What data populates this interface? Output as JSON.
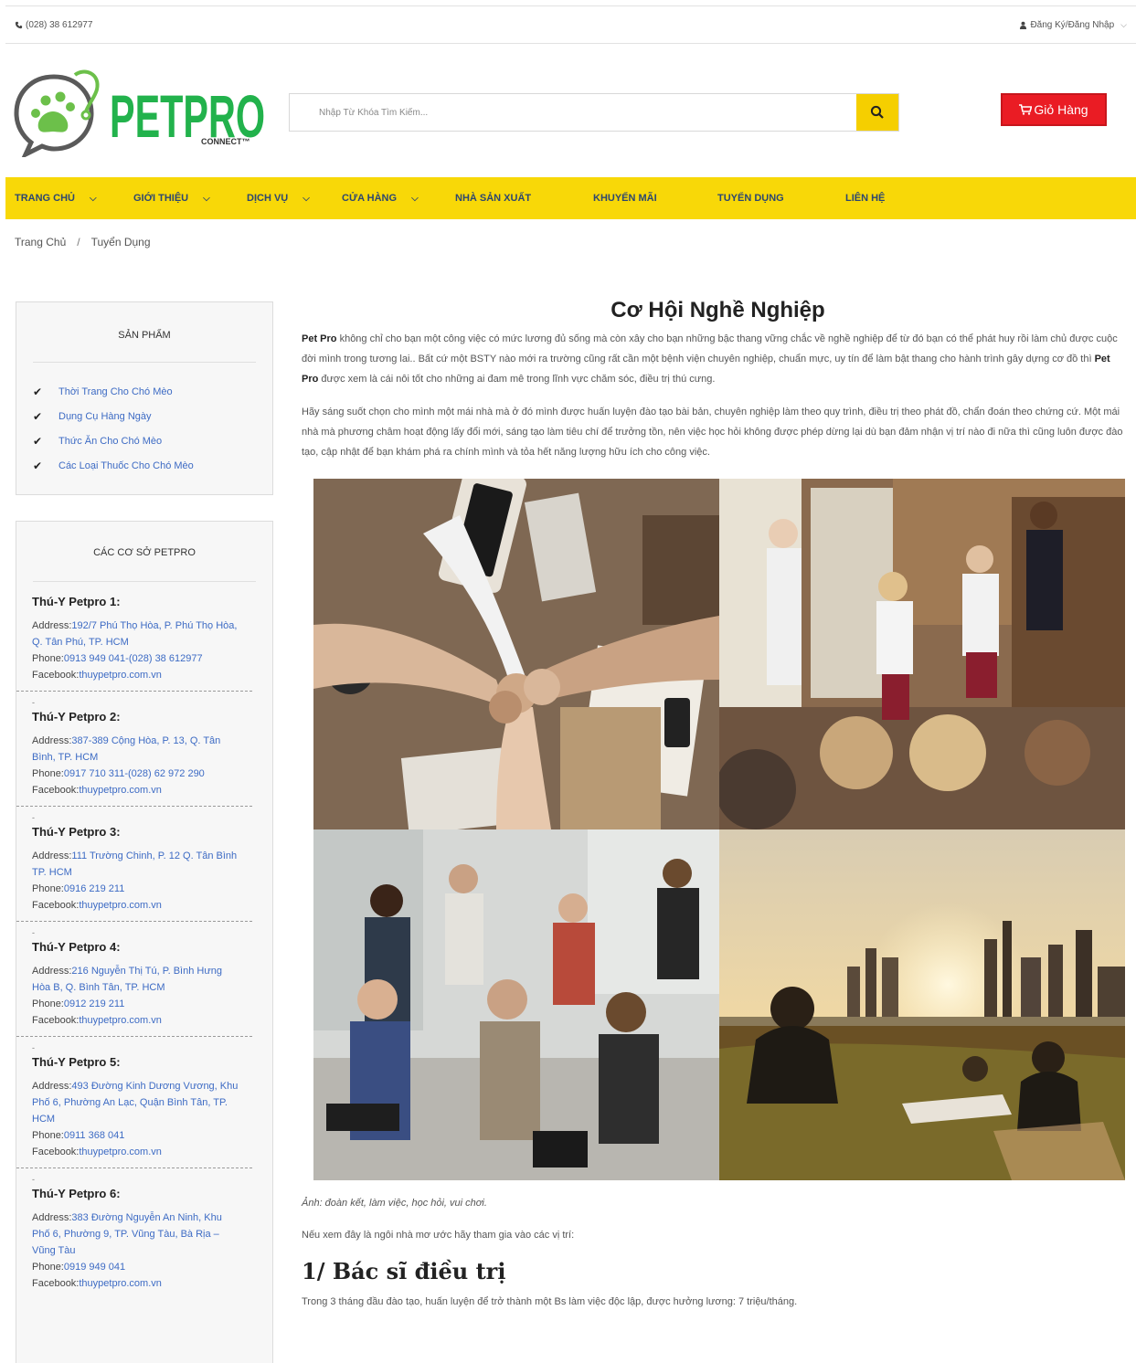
{
  "topbar": {
    "phone": "(028) 38 612977",
    "account": "Đăng Ký/Đăng Nhập"
  },
  "logo": {
    "main": "PETPRO",
    "sub": "CONNECT™"
  },
  "search": {
    "placeholder": "Nhập Từ Khóa Tìm Kiếm..."
  },
  "cart": {
    "label": "Giỏ Hàng"
  },
  "nav": [
    {
      "label": "TRANG CHỦ",
      "dropdown": true
    },
    {
      "label": "GIỚI THIỆU",
      "dropdown": true
    },
    {
      "label": "DỊCH VỤ",
      "dropdown": true
    },
    {
      "label": "CỬA HÀNG",
      "dropdown": true
    },
    {
      "label": "NHÀ SẢN XUẤT",
      "dropdown": false
    },
    {
      "label": "KHUYẾN MÃI",
      "dropdown": false
    },
    {
      "label": "TUYỂN DỤNG",
      "dropdown": false
    },
    {
      "label": "LIÊN HỆ",
      "dropdown": false
    }
  ],
  "breadcrumb": {
    "home": "Trang Chủ",
    "sep": "/",
    "current": "Tuyển Dụng"
  },
  "sidebar": {
    "products_title": "SẢN PHẨM",
    "products": [
      "Thời Trang Cho Chó Mèo",
      "Dụng Cụ Hàng Ngày",
      "Thức Ăn Cho Chó Mèo",
      "Các Loại Thuốc Cho Chó Mèo"
    ],
    "branches_title": "CÁC CƠ SỞ PETPRO",
    "labels": {
      "address": "Address:",
      "phone": "Phone:",
      "facebook": "Facebook:"
    },
    "branches": [
      {
        "name": "Thú-Y Petpro 1:",
        "address": "192/7 Phú Thọ Hòa, P. Phú Thọ Hòa, Q. Tân Phú, TP. HCM",
        "phone": "0913 949 041-(028) 38 612977",
        "facebook": "thuypetpro.com.vn"
      },
      {
        "name": "Thú-Y Petpro 2:",
        "address": "387-389 Cộng Hòa, P. 13, Q. Tân Bình, TP. HCM",
        "phone": "0917 710 311-(028) 62 972 290",
        "facebook": "thuypetpro.com.vn"
      },
      {
        "name": "Thú-Y Petpro 3:",
        "address": "111 Trường Chinh, P. 12 Q. Tân Bình TP. HCM",
        "phone": "0916 219 211",
        "facebook": "thuypetpro.com.vn"
      },
      {
        "name": "Thú-Y Petpro 4:",
        "address": "216 Nguyễn Thị Tú, P. Bình Hưng Hòa B, Q. Bình Tân, TP. HCM",
        "phone": "0912 219 211",
        "facebook": "thuypetpro.com.vn"
      },
      {
        "name": "Thú-Y Petpro 5:",
        "address": "493 Đường Kinh Dương Vương, Khu Phố 6, Phường An Lạc, Quận Bình Tân, TP. HCM",
        "phone": "0911 368 041",
        "facebook": "thuypetpro.com.vn"
      },
      {
        "name": "Thú-Y Petpro 6:",
        "address": "383 Đường Nguyễn An Ninh, Khu Phố 6, Phường 9, TP. Vũng Tàu, Bà Rịa – Vũng Tàu",
        "phone": "0919 949 041",
        "facebook": "thuypetpro.com.vn"
      }
    ]
  },
  "article": {
    "title": "Cơ Hội Nghề Nghiệp",
    "p1_brand": "Pet Pro",
    "p1a": " không chỉ cho bạn một công việc có mức lương đủ sống mà còn xây cho bạn những bậc thang vững chắc về nghề nghiệp để từ đó bạn có thể phát huy rồi làm chủ được cuộc đời mình trong tương lai.. Bất cứ một BSTY nào mới ra trường cũng rất cần một bệnh viện chuyên nghiệp, chuẩn mực, uy tín để làm bật thang cho hành trình gây dựng cơ đồ thì ",
    "p1_brand2": "Pet Pro",
    "p1b": " được xem là cái nôi tốt cho những ai đam mê trong lĩnh vực chăm sóc, điều trị thú cưng.",
    "p2": "Hãy sáng suốt chọn cho mình một mái nhà mà ở đó mình được huấn luyện đào tạo bài bản, chuyên nghiệp làm theo quy trình, điều trị theo phát đồ, chẩn đoán theo chứng cứ. Một mái nhà mà phương châm hoạt động lấy đổi mới, sáng tạo làm tiêu chí để trưởng tồn, nên việc học hỏi không được phép dừng lại dù bạn đảm nhận vị trí nào đi nữa thì cũng luôn được đào tạo, cập nhật để bạn khám phá ra chính mình và tỏa hết năng lượng hữu ích cho công việc.",
    "caption": "Ảnh: đoàn kết, làm việc, học hỏi, vui chơi.",
    "p3": "Nếu xem đây là ngôi nhà mơ ước hãy tham gia vào các vị trí:",
    "h2": "1/ Bác sĩ điều trị",
    "p4": "Trong 3 tháng đầu đào tạo, huấn luyện để trở thành một Bs làm việc độc lập, được hưởng lương: 7 triệu/tháng."
  },
  "colors": {
    "nav_bg": "#f8d808",
    "cart_bg": "#ea1c24",
    "brand_green": "#22b24c",
    "link": "#3d6bc4"
  }
}
